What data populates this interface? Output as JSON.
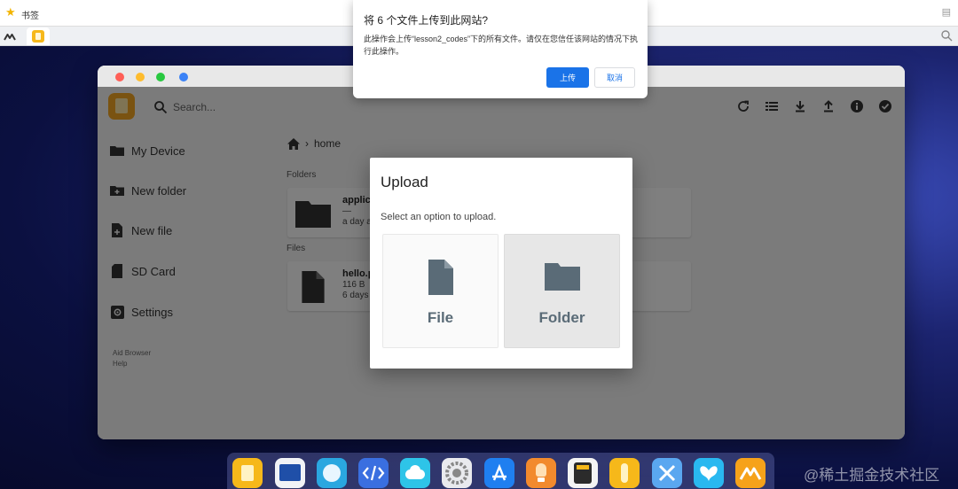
{
  "browser": {
    "bookmark_label": "书签"
  },
  "window": {
    "search_placeholder": "Search...",
    "toolbar_icons": [
      "refresh-icon",
      "list-view-icon",
      "download-icon",
      "upload-icon",
      "info-icon",
      "select-all-icon"
    ]
  },
  "sidebar": {
    "items": [
      {
        "label": "My Device",
        "icon": "folder-icon"
      },
      {
        "label": "New folder",
        "icon": "new-folder-icon"
      },
      {
        "label": "New file",
        "icon": "new-file-icon"
      },
      {
        "label": "SD Card",
        "icon": "sd-card-icon"
      },
      {
        "label": "Settings",
        "icon": "settings-icon"
      }
    ],
    "footer": [
      "Aid Browser",
      "Help"
    ]
  },
  "main": {
    "breadcrumb": "home",
    "folders_label": "Folders",
    "files_label": "Files",
    "folders": [
      {
        "name": "applic",
        "meta1": "—",
        "meta2": "a day a"
      }
    ],
    "files": [
      {
        "name": "hello.p",
        "meta1": "116 B",
        "meta2": "6 days"
      }
    ]
  },
  "upload_dialog": {
    "title": "Upload",
    "description": "Select an option to upload.",
    "options": [
      {
        "label": "File",
        "icon": "file-icon"
      },
      {
        "label": "Folder",
        "icon": "folder-icon"
      }
    ]
  },
  "permission_dialog": {
    "title": "将 6 个文件上传到此网站?",
    "body": "此操作会上传“lesson2_codes”下的所有文件。请仅在您信任该网站的情况下执行此操作。",
    "upload_button": "上传",
    "cancel_button": "取消"
  },
  "dock": {
    "apps": [
      "files-app-icon",
      "terminal-app-icon",
      "browser-app-icon",
      "code-editor-app-icon",
      "cloud-app-icon",
      "system-settings-app-icon",
      "app-store-app-icon",
      "lightbulb-app-icon",
      "calculator-app-icon",
      "touch-app-icon",
      "tools-app-icon",
      "butterfly-app-icon",
      "aid-app-icon"
    ]
  },
  "watermark": "@稀土掘金技术社区",
  "colors": {
    "accent": "#1a73e8",
    "app_logo": "#f5a623",
    "upload_icon": "#5a6b77"
  }
}
